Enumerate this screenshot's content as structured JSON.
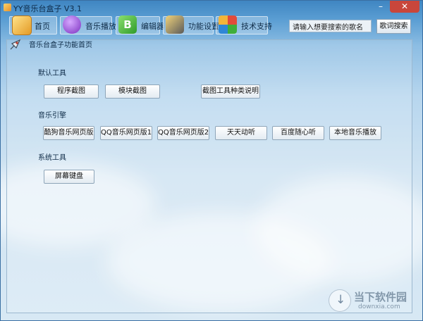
{
  "window": {
    "title": "YY音乐台盒子 V3.1"
  },
  "tabs": [
    {
      "label": "首页",
      "icon": "home-cube-icon",
      "color": "#f3b53a"
    },
    {
      "label": "音乐播放",
      "icon": "music-note-icon",
      "color": "#9b4fd0"
    },
    {
      "label": "编辑器",
      "icon": "editor-b-icon",
      "color": "#3fae3a"
    },
    {
      "label": "功能设置",
      "icon": "settings-icon",
      "color": "#6c6c6c"
    },
    {
      "label": "技术支持",
      "icon": "support-blocks-icon",
      "color": "#2f86d6"
    }
  ],
  "search": {
    "value": "请输入想要搜索的歌名",
    "button": "歌词搜索"
  },
  "page": {
    "heading": "音乐台盒子功能首页",
    "heading_icon": "rocket-icon"
  },
  "sections": {
    "default_tools": {
      "title": "默认工具",
      "buttons": [
        "程序截图",
        "模块截图",
        "截图工具种类说明"
      ]
    },
    "music_engine": {
      "title": "音乐引擎",
      "buttons": [
        "酷狗音乐网页版",
        "QQ音乐网页版1",
        "QQ音乐网页版2",
        "天天动听",
        "百度随心听",
        "本地音乐播放"
      ]
    },
    "system_tools": {
      "title": "系统工具",
      "buttons": [
        "屏幕键盘"
      ]
    }
  },
  "watermark": {
    "name": "当下软件园",
    "domain": "downxia.com"
  }
}
